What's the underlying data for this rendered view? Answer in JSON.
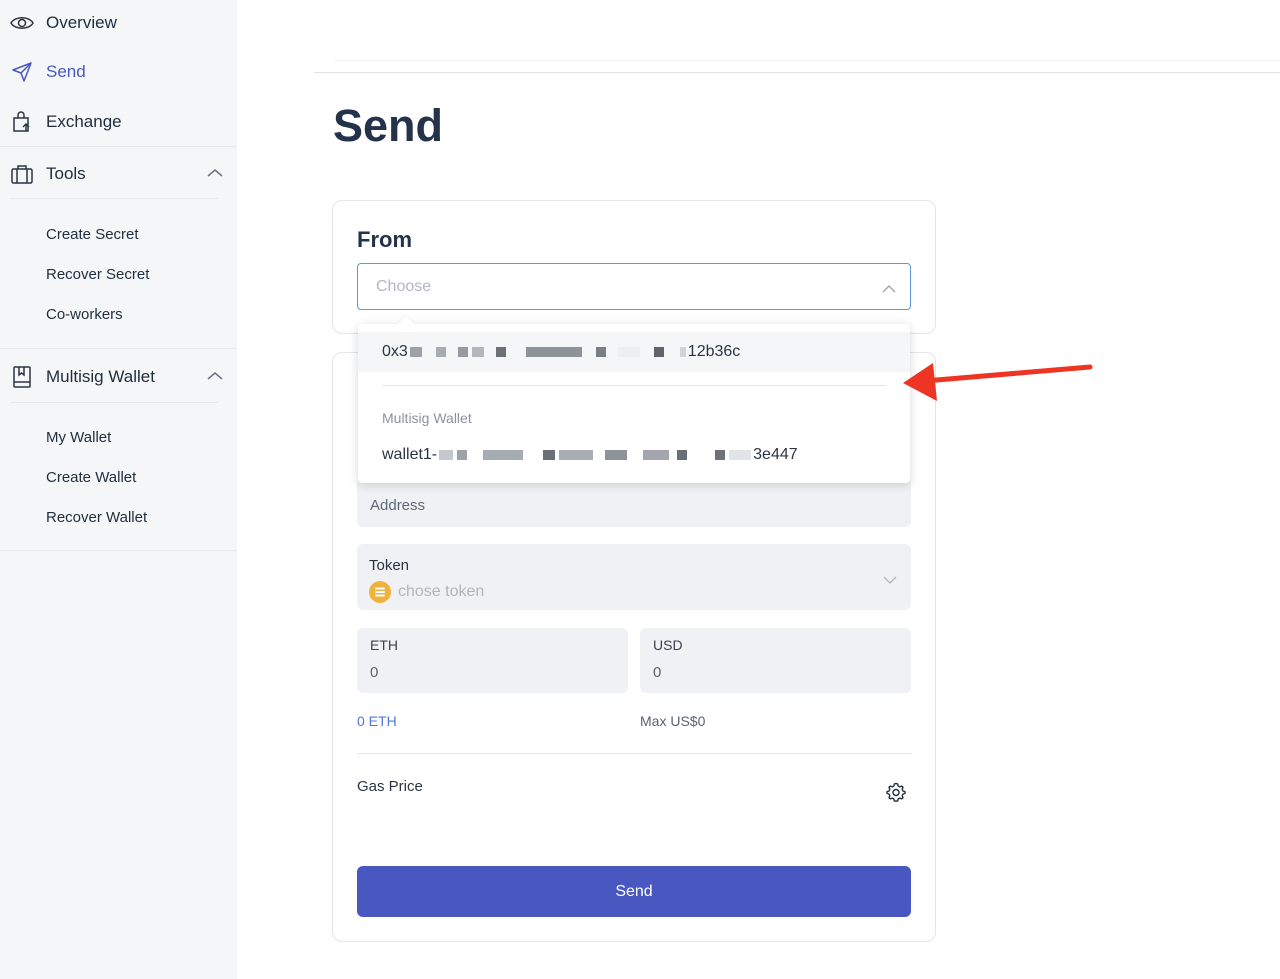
{
  "sidebar": {
    "overview": "Overview",
    "send": "Send",
    "exchange": "Exchange",
    "tools": "Tools",
    "tools_items": [
      "Create Secret",
      "Recover Secret",
      "Co-workers"
    ],
    "multisig": "Multisig Wallet",
    "multisig_items": [
      "My Wallet",
      "Create Wallet",
      "Recover Wallet"
    ]
  },
  "page": {
    "title": "Send"
  },
  "from": {
    "title": "From",
    "placeholder": "Choose",
    "options": {
      "account_prefix": "0x3",
      "account_suffix": "12b36c",
      "group_label": "Multisig Wallet",
      "wallet_prefix": "wallet1-",
      "wallet_suffix": "3e447"
    }
  },
  "address": {
    "placeholder": "Address"
  },
  "token": {
    "label": "Token",
    "placeholder": "chose token"
  },
  "amount": {
    "eth_label": "ETH",
    "eth_value": "0",
    "usd_label": "USD",
    "usd_value": "0",
    "eth_balance": "0 ETH",
    "max_usd": "Max US$0"
  },
  "gas": {
    "label": "Gas Price"
  },
  "actions": {
    "send_label": "Send"
  },
  "colors": {
    "accent": "#4958c0",
    "active_nav": "#4858c2",
    "arrow": "#ee3524"
  }
}
